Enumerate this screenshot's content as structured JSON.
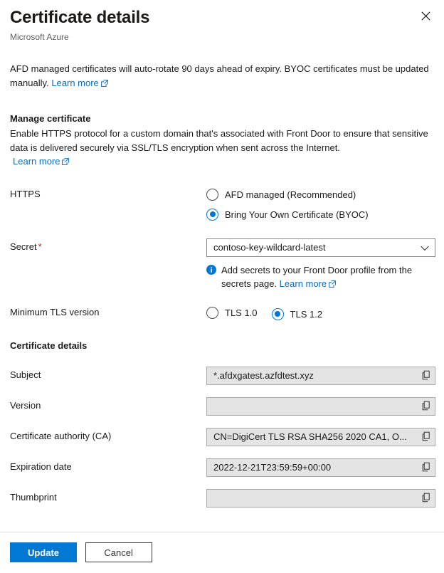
{
  "header": {
    "title": "Certificate details",
    "subtitle": "Microsoft Azure",
    "close_icon": "close-icon"
  },
  "intro": {
    "text": "AFD managed certificates will auto-rotate 90 days ahead of expiry. BYOC certificates must be updated manually.",
    "link_label": "Learn more"
  },
  "manage_section": {
    "heading": "Manage certificate",
    "description": "Enable HTTPS protocol for a custom domain that's associated with Front Door to ensure that sensitive data is delivered securely via SSL/TLS encryption when sent across the Internet.",
    "link_label": "Learn more"
  },
  "https_row": {
    "label": "HTTPS",
    "options": [
      {
        "label": "AFD managed (Recommended)",
        "selected": false
      },
      {
        "label": "Bring Your Own Certificate (BYOC)",
        "selected": true
      }
    ]
  },
  "secret_row": {
    "label": "Secret",
    "required_marker": "*",
    "selected_value": "contoso-key-wildcard-latest",
    "chevron_icon": "chevron-down-icon",
    "info": {
      "icon": "info-icon",
      "text": "Add secrets to your Front Door profile from the secrets page.",
      "link_label": "Learn more"
    }
  },
  "tls_row": {
    "label": "Minimum TLS version",
    "options": [
      {
        "label": "TLS 1.0",
        "selected": false
      },
      {
        "label": "TLS 1.2",
        "selected": true
      }
    ]
  },
  "details_section": {
    "heading": "Certificate details",
    "copy_icon": "copy-icon",
    "fields": [
      {
        "label": "Subject",
        "value": "*.afdxgatest.azfdtest.xyz"
      },
      {
        "label": "Version",
        "value": ""
      },
      {
        "label": "Certificate authority (CA)",
        "value": "CN=DigiCert TLS RSA SHA256 2020 CA1, O..."
      },
      {
        "label": "Expiration date",
        "value": "2022-12-21T23:59:59+00:00"
      },
      {
        "label": "Thumbprint",
        "value": ""
      }
    ]
  },
  "footer": {
    "update_label": "Update",
    "cancel_label": "Cancel"
  },
  "colors": {
    "accent": "#0078d4",
    "link": "#0f6cbd",
    "required": "#a4262c",
    "readonly_bg": "#e4e4e4"
  }
}
